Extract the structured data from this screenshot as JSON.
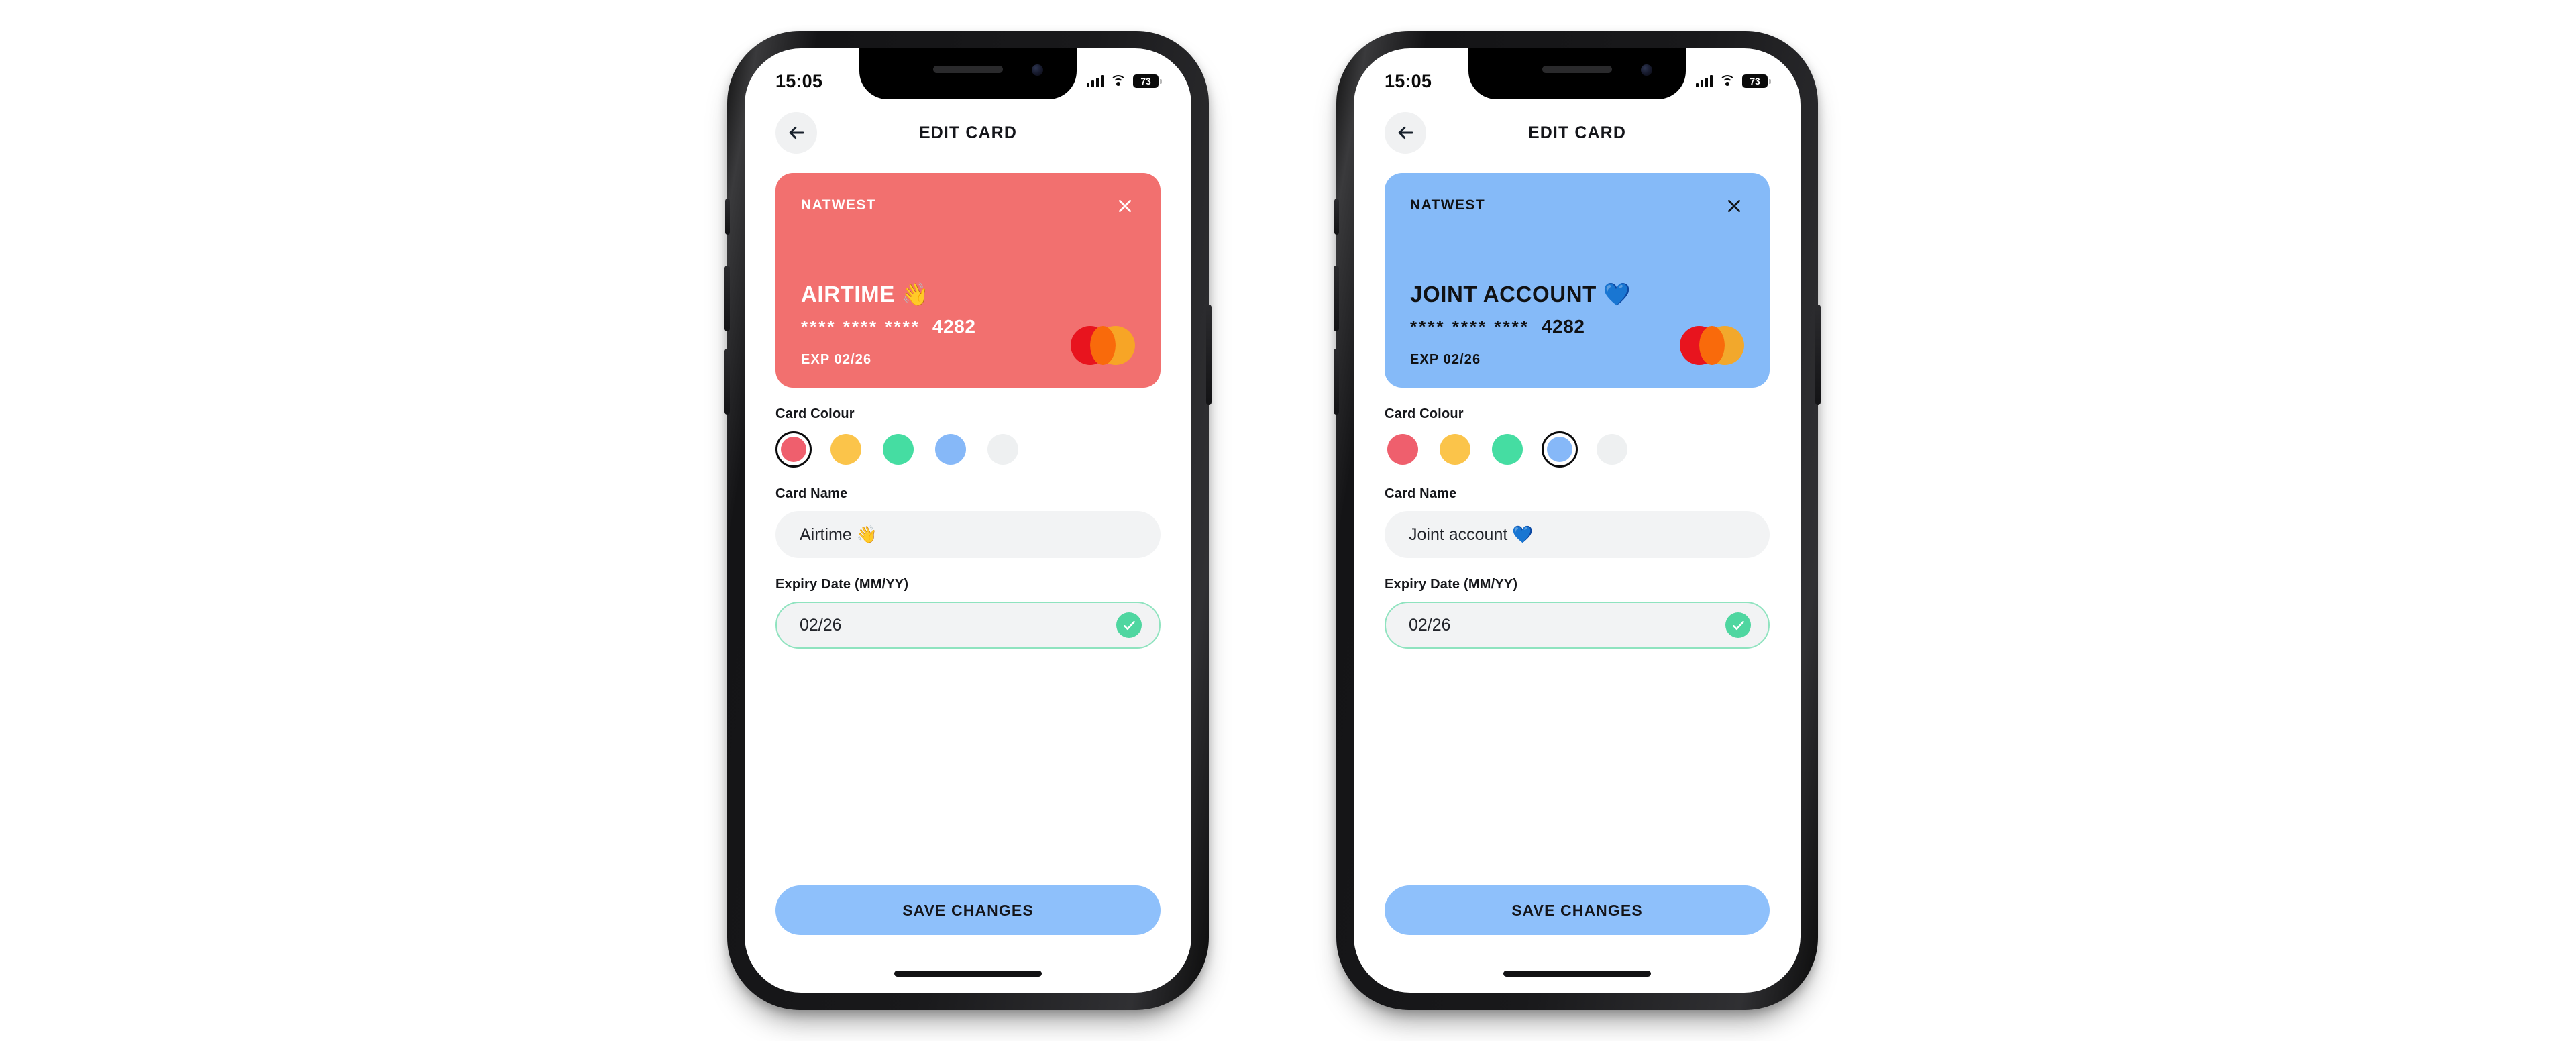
{
  "phones": [
    {
      "id": "phone-left",
      "status": {
        "time": "15:05",
        "battery": "73",
        "wifi_icon": "wifi-icon",
        "signal_icon": "signal-bars-icon"
      },
      "header": {
        "title": "EDIT CARD",
        "back_icon": "arrow-left-icon"
      },
      "card": {
        "theme": "red",
        "bg": "#f2706f",
        "text_color": "#ffffff",
        "bank": "NATWEST",
        "name": "AIRTIME",
        "name_emoji": "👋",
        "number_mask": "****  ****  ****",
        "number_last4": "4282",
        "expiry": "EXP 02/26",
        "close_icon": "close-icon",
        "network_icon": "mastercard-icon"
      },
      "form": {
        "colour_label": "Card Colour",
        "swatches": [
          {
            "name": "coral",
            "hex": "#ef5f6d",
            "selected": true
          },
          {
            "name": "amber",
            "hex": "#fbc44a",
            "selected": false
          },
          {
            "name": "mint",
            "hex": "#45dda2",
            "selected": false
          },
          {
            "name": "blue",
            "hex": "#86b8f8",
            "selected": false
          },
          {
            "name": "grey",
            "hex": "#eef0f1",
            "selected": false
          }
        ],
        "name_label": "Card Name",
        "name_value": "Airtime 👋",
        "expiry_label": "Expiry Date (MM/YY)",
        "expiry_value": "02/26",
        "expiry_valid": true,
        "valid_icon": "check-circle-icon"
      },
      "save_label": "SAVE CHANGES"
    },
    {
      "id": "phone-right",
      "status": {
        "time": "15:05",
        "battery": "73",
        "wifi_icon": "wifi-icon",
        "signal_icon": "signal-bars-icon"
      },
      "header": {
        "title": "EDIT CARD",
        "back_icon": "arrow-left-icon"
      },
      "card": {
        "theme": "blue",
        "bg": "#85baf8",
        "text_color": "#101113",
        "bank": "NATWEST",
        "name": "JOINT ACCOUNT",
        "name_emoji": "💙",
        "number_mask": "****  ****  ****",
        "number_last4": "4282",
        "expiry": "EXP 02/26",
        "close_icon": "close-icon",
        "network_icon": "mastercard-icon"
      },
      "form": {
        "colour_label": "Card Colour",
        "swatches": [
          {
            "name": "coral",
            "hex": "#ef5f6d",
            "selected": false
          },
          {
            "name": "amber",
            "hex": "#fbc44a",
            "selected": false
          },
          {
            "name": "mint",
            "hex": "#45dda2",
            "selected": false
          },
          {
            "name": "blue",
            "hex": "#86b8f8",
            "selected": true
          },
          {
            "name": "grey",
            "hex": "#eef0f1",
            "selected": false
          }
        ],
        "name_label": "Card Name",
        "name_value": "Joint account 💙",
        "expiry_label": "Expiry Date (MM/YY)",
        "expiry_value": "02/26",
        "expiry_valid": true,
        "valid_icon": "check-circle-icon"
      },
      "save_label": "SAVE CHANGES"
    }
  ],
  "theme": {
    "accent_blue": "#8ec0fb",
    "valid_green": "#4fd6a0",
    "input_bg": "#f2f3f4",
    "page_bg": "#ffffff"
  }
}
